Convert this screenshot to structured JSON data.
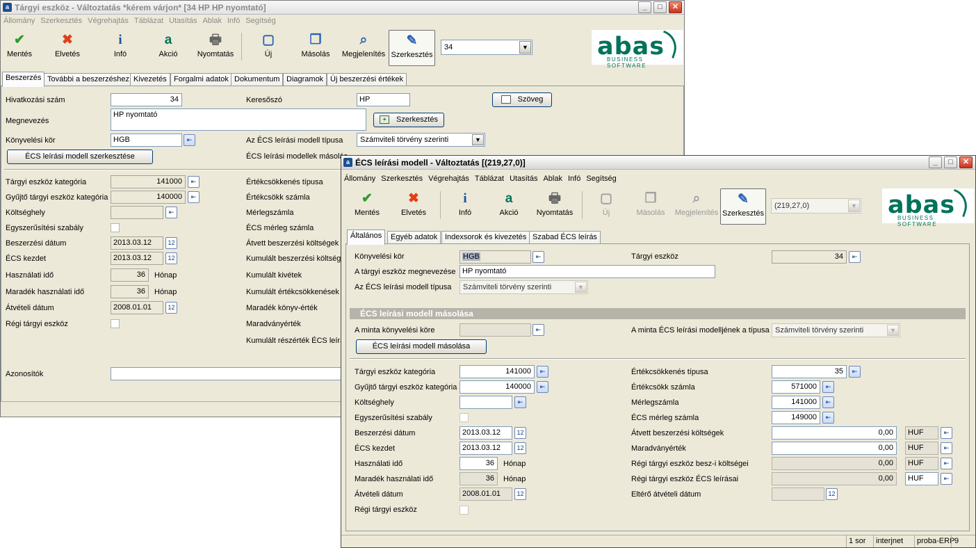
{
  "back": {
    "title": "Tárgyi eszköz - Változtatás  *kérem várjon*  [34   HP   HP nyomtató]",
    "menu": [
      "Állomány",
      "Szerkesztés",
      "Végrehajtás",
      "Táblázat",
      "Utasítás",
      "Ablak",
      "Infó",
      "Segítség"
    ],
    "toolbar": {
      "save": "Mentés",
      "discard": "Elvetés",
      "info": "Infó",
      "action": "Akció",
      "print": "Nyomtatás",
      "new": "Új",
      "copy": "Másolás",
      "view": "Megjelenítés",
      "edit": "Szerkesztés",
      "combo": "34"
    },
    "tabs": [
      "Beszerzés",
      "További a beszerzéshez",
      "Kivezetés",
      "Forgalmi adatok",
      "Dokumentum",
      "Diagramok",
      "Új beszerzési értékek"
    ],
    "labels": {
      "ref": "Hivatkozási szám",
      "keyword": "Keresőszó",
      "name": "Megnevezés",
      "ledger": "Könyvelési kör",
      "model_type": "Az ÉCS leírási modell típusa",
      "model_copy": "ÉCS leírási modellek másolás",
      "category": "Tárgyi eszköz kategória",
      "coll_category": "Gyűjtő tárgyi eszköz kategória",
      "cost_center": "Költséghely",
      "simpl": "Egyszerűsítési szabály",
      "purch_date": "Beszerzési dátum",
      "ecs_start": "ÉCS kezdet",
      "use_time": "Használati idő",
      "rem_time": "Maradék használati idő",
      "take_date": "Átvételi dátum",
      "old_asset": "Régi tárgyi eszköz",
      "dep_type": "Értékcsökkenés típusa",
      "dep_acct": "Értékcsökk számla",
      "bal_acct": "Mérlegszámla",
      "ecs_bal": "ÉCS mérleg számla",
      "taken_costs": "Átvett beszerzési költségek",
      "cum_costs": "Kumulált beszerzési költség",
      "cum_out": "Kumulált kivétek",
      "cum_dep": "Kumulált értékcsökkenések",
      "rem_book": "Maradék könyv-érték",
      "residual": "Maradványérték",
      "cum_partial": "Kumulált részérték ÉCS leírás",
      "ids": "Azonosítók",
      "month": "Hónap"
    },
    "values": {
      "ref": "34",
      "keyword": "HP",
      "name": "HP nyomtató",
      "ledger": "HGB",
      "model_type": "Számviteli törvény szerinti",
      "category": "141000",
      "coll_category": "140000",
      "purch_date": "2013.03.12",
      "ecs_start": "2013.03.12",
      "use_time": "36",
      "rem_time": "36",
      "take_date": "2008.01.01"
    },
    "buttons": {
      "text": "Szöveg",
      "edit": "Szerkesztés",
      "model_edit": "ÉCS leírási modell szerkesztése"
    }
  },
  "front": {
    "title": "ÉCS leírási modell - Változtatás  [(219,27,0)]",
    "menu": [
      "Állomány",
      "Szerkesztés",
      "Végrehajtás",
      "Táblázat",
      "Utasítás",
      "Ablak",
      "Infó",
      "Segítség"
    ],
    "toolbar": {
      "save": "Mentés",
      "discard": "Elvetés",
      "info": "Infó",
      "action": "Akció",
      "print": "Nyomtatás",
      "new": "Új",
      "copy": "Másolás",
      "view": "Megjelenítés",
      "edit": "Szerkesztés",
      "combo": "(219,27,0)"
    },
    "tabs": [
      "Általános",
      "Egyéb adatok",
      "Indexsorok és kivezetés",
      "Szabad ÉCS leírás"
    ],
    "labels": {
      "ledger": "Könyvelési kör",
      "asset": "Tárgyi eszköz",
      "asset_name": "A tárgyi eszköz megnevezése",
      "model_type": "Az ÉCS leírási modell típusa",
      "section": "ÉCS leírási modell másolása",
      "tpl_ledger": "A minta könyvelési köre",
      "tpl_type": "A minta ÉCS leírási modelljének a típusa",
      "category": "Tárgyi eszköz kategória",
      "coll_category": "Gyűjtő tárgyi eszköz kategória",
      "cost_center": "Költséghely",
      "simpl": "Egyszerűsítési szabály",
      "purch_date": "Beszerzési dátum",
      "ecs_start": "ÉCS kezdet",
      "use_time": "Használati idő",
      "rem_time": "Maradék használati idő",
      "take_date": "Átvételi dátum",
      "old_asset": "Régi tárgyi eszköz",
      "dep_type": "Értékcsökkenés típusa",
      "dep_acct": "Értékcsökk számla",
      "bal_acct": "Mérlegszámla",
      "ecs_bal": "ÉCS mérleg számla",
      "taken_costs": "Átvett beszerzési költségek",
      "residual": "Maradványérték",
      "old_costs": "Régi tárgyi eszköz besz-i költségei",
      "old_dep": "Régi tárgyi eszköz ÉCS leírásai",
      "diff_date": "Eltérő átvételi dátum",
      "month": "Hónap"
    },
    "values": {
      "ledger": "HGB",
      "asset": "34",
      "asset_name": "HP nyomtató",
      "model_type": "Számviteli törvény szerinti",
      "tpl_type": "Számviteli törvény szerinti",
      "category": "141000",
      "coll_category": "140000",
      "purch_date": "2013.03.12",
      "ecs_start": "2013.03.12",
      "use_time": "36",
      "rem_time": "36",
      "take_date": "2008.01.01",
      "dep_type": "35",
      "dep_acct": "571000",
      "bal_acct": "141000",
      "ecs_bal": "149000",
      "taken_costs": "0,00",
      "residual": "0,00",
      "old_costs": "0,00",
      "old_dep": "0,00",
      "currency": "HUF"
    },
    "buttons": {
      "copy_model": "ÉCS leírási modell másolása"
    },
    "status": [
      "1 sor",
      "interjnet",
      "proba-ERP",
      "9"
    ]
  },
  "logo": {
    "word": "abas",
    "sub": "BUSINESS SOFTWARE",
    "color": "#00735a"
  }
}
